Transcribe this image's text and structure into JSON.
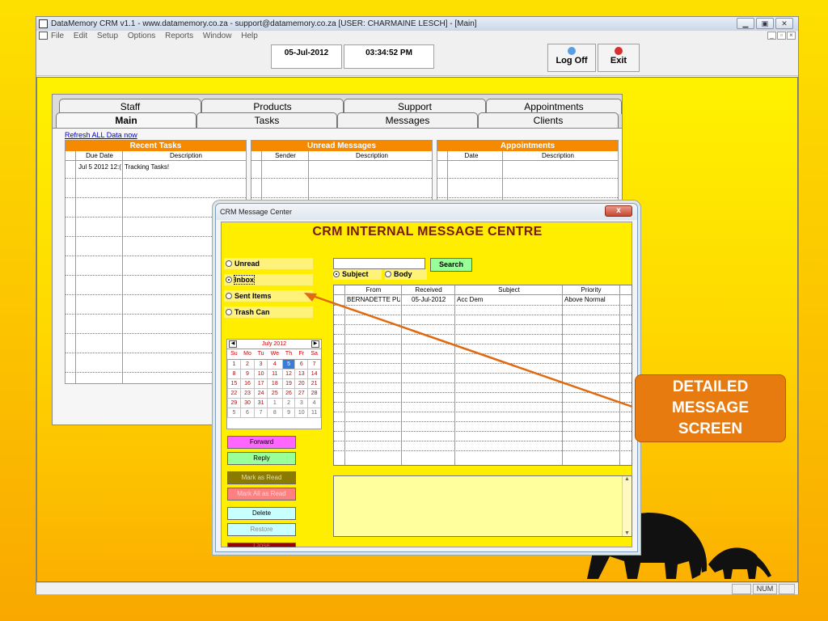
{
  "window": {
    "title": "DataMemory CRM v1.1 - www.datamemory.co.za - support@datamemory.co.za [USER: CHARMAINE LESCH] - [Main]",
    "menu": [
      "File",
      "Edit",
      "Setup",
      "Options",
      "Reports",
      "Window",
      "Help"
    ]
  },
  "toolbar": {
    "date": "05-Jul-2012",
    "time": "03:34:52 PM",
    "logoff_label": "Log Off",
    "exit_label": "Exit"
  },
  "main": {
    "tabs_row1": [
      "Staff",
      "Products",
      "Support",
      "Appointments"
    ],
    "tabs_row2": [
      "Main",
      "Tasks",
      "Messages",
      "Clients"
    ],
    "selected_tab": "Main",
    "refresh_link": "Refresh ALL Data now",
    "recent_tasks": {
      "title": "Recent Tasks",
      "columns": [
        "Due Date",
        "Description"
      ],
      "rows": [
        [
          "Jul  5 2012 12:(",
          "Tracking Tasks!"
        ]
      ]
    },
    "unread_messages": {
      "title": "Unread Messages",
      "columns": [
        "Sender",
        "Description"
      ]
    },
    "appointments": {
      "title": "Appointments",
      "columns": [
        "Date",
        "Description"
      ]
    }
  },
  "dialog": {
    "title": "CRM Message Center",
    "heading": "CRM INTERNAL MESSAGE CENTRE",
    "close_label": "x",
    "folders": [
      {
        "label": "Unread",
        "selected": false
      },
      {
        "label": "Inbox",
        "selected": true
      },
      {
        "label": "Sent Items",
        "selected": false
      },
      {
        "label": "Trash Can",
        "selected": false
      }
    ],
    "calendar": {
      "month_label": "July 2012",
      "days_of_week": [
        "Su",
        "Mo",
        "Tu",
        "We",
        "Th",
        "Fr",
        "Sa"
      ],
      "weeks": [
        [
          "1",
          "2",
          "3",
          "4",
          "5",
          "6",
          "7"
        ],
        [
          "8",
          "9",
          "10",
          "11",
          "12",
          "13",
          "14"
        ],
        [
          "15",
          "16",
          "17",
          "18",
          "19",
          "20",
          "21"
        ],
        [
          "22",
          "23",
          "24",
          "25",
          "26",
          "27",
          "28"
        ],
        [
          "29",
          "30",
          "31",
          "1",
          "2",
          "3",
          "4"
        ],
        [
          "5",
          "6",
          "7",
          "8",
          "9",
          "10",
          "11"
        ]
      ],
      "today": "5"
    },
    "search": {
      "value": "",
      "button_label": "Search",
      "scope_subject": "Subject",
      "scope_body": "Body",
      "scope_selected": "Subject"
    },
    "message_table": {
      "columns": [
        "From",
        "Received",
        "Subject",
        "Priority"
      ],
      "rows": [
        [
          "BERNADETTE PUR",
          "05-Jul-2012",
          "Acc Dem",
          "Above Normal"
        ]
      ]
    },
    "buttons": {
      "forward": "Forward",
      "reply": "Reply",
      "mark_read": "Mark as Read",
      "mark_all_read": "Mark All as Read",
      "delete": "Delete",
      "restore": "Restore",
      "close": "Close"
    },
    "preview_text": ""
  },
  "statusbar": {
    "num": "NUM"
  },
  "callout": {
    "line1": "DETAILED",
    "line2": "MESSAGE",
    "line3": "SCREEN"
  },
  "colors": {
    "accent_orange": "#f58a00",
    "dialog_bg": "#ffee00",
    "callout": "#e77b10"
  }
}
